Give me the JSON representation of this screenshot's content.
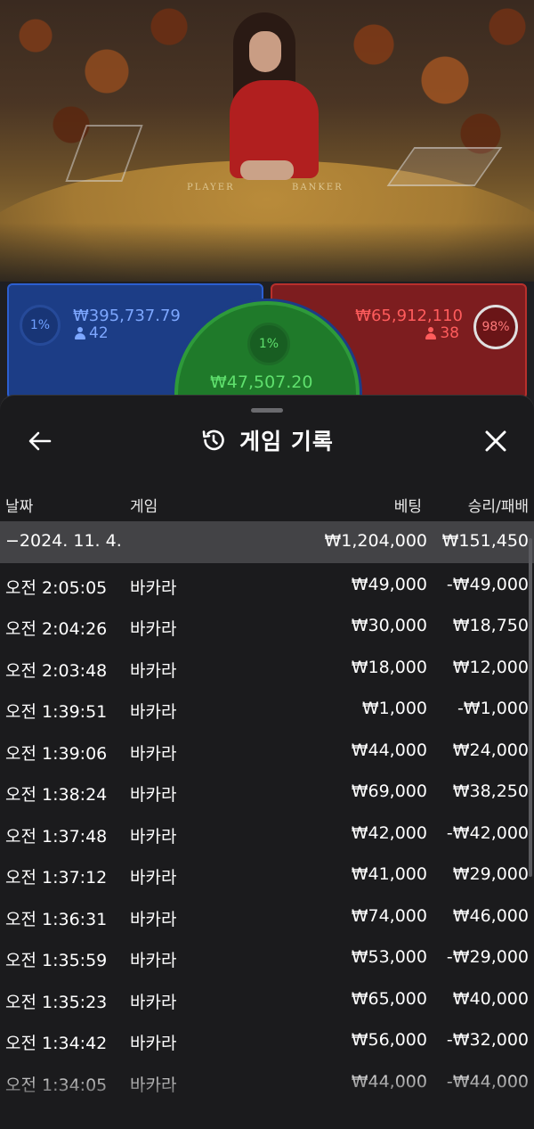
{
  "table": {
    "player_label": "PLAYER",
    "banker_label": "BANKER",
    "player": {
      "percent": "1%",
      "amount": "₩395,737.79",
      "count": "42"
    },
    "tie": {
      "percent": "1%",
      "amount": "₩47,507.20"
    },
    "banker": {
      "percent": "98%",
      "amount": "₩65,912,110",
      "count": "38"
    }
  },
  "history": {
    "title": "게임 기록",
    "icons": {
      "back": "back-arrow-icon",
      "history": "history-clock-icon",
      "close": "close-icon"
    },
    "columns": {
      "date": "날짜",
      "game": "게임",
      "bet": "베팅",
      "result": "승리/패배"
    },
    "summary": {
      "date": "−2024. 11. 4.",
      "bet": "₩1,204,000",
      "result": "₩151,450"
    },
    "rows": [
      {
        "time": "오전 2:05:05",
        "game": "바카라",
        "bet": "₩49,000",
        "result": "-₩49,000"
      },
      {
        "time": "오전 2:04:26",
        "game": "바카라",
        "bet": "₩30,000",
        "result": "₩18,750"
      },
      {
        "time": "오전 2:03:48",
        "game": "바카라",
        "bet": "₩18,000",
        "result": "₩12,000"
      },
      {
        "time": "오전 1:39:51",
        "game": "바카라",
        "bet": "₩1,000",
        "result": "-₩1,000"
      },
      {
        "time": "오전 1:39:06",
        "game": "바카라",
        "bet": "₩44,000",
        "result": "₩24,000"
      },
      {
        "time": "오전 1:38:24",
        "game": "바카라",
        "bet": "₩69,000",
        "result": "₩38,250"
      },
      {
        "time": "오전 1:37:48",
        "game": "바카라",
        "bet": "₩42,000",
        "result": "-₩42,000"
      },
      {
        "time": "오전 1:37:12",
        "game": "바카라",
        "bet": "₩41,000",
        "result": "₩29,000"
      },
      {
        "time": "오전 1:36:31",
        "game": "바카라",
        "bet": "₩74,000",
        "result": "₩46,000"
      },
      {
        "time": "오전 1:35:59",
        "game": "바카라",
        "bet": "₩53,000",
        "result": "-₩29,000"
      },
      {
        "time": "오전 1:35:23",
        "game": "바카라",
        "bet": "₩65,000",
        "result": "₩40,000"
      },
      {
        "time": "오전 1:34:42",
        "game": "바카라",
        "bet": "₩56,000",
        "result": "-₩32,000"
      },
      {
        "time": "오전 1:34:05",
        "game": "바카라",
        "bet": "₩44,000",
        "result": "-₩44,000"
      }
    ]
  },
  "colors": {
    "player": "#1c3d86",
    "banker": "#7d1d1f",
    "tie": "#1f7a2a",
    "sheet": "#1b1b1d"
  }
}
